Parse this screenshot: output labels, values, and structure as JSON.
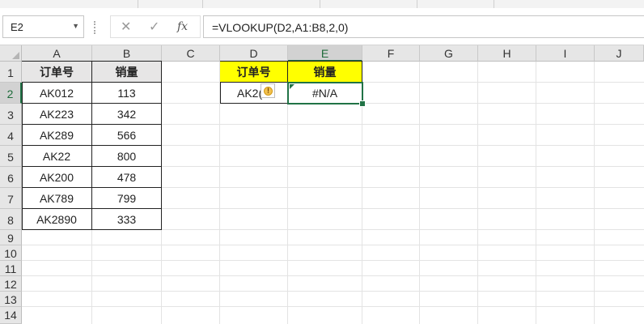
{
  "formula_bar": {
    "name_box": "E2",
    "cancel_icon": "✕",
    "enter_icon": "✓",
    "fx_label": "fx",
    "formula": "=VLOOKUP(D2,A1:B8,2,0)"
  },
  "columns": [
    "A",
    "B",
    "C",
    "D",
    "E",
    "F",
    "G",
    "H",
    "I",
    "J"
  ],
  "rows": [
    "1",
    "2",
    "3",
    "4",
    "5",
    "6",
    "7",
    "8",
    "9",
    "10",
    "11",
    "12",
    "13",
    "14"
  ],
  "selected": {
    "column": "E",
    "row": "2"
  },
  "table_left": {
    "headers": [
      "订单号",
      "销量"
    ],
    "rows": [
      [
        "AK012",
        "113"
      ],
      [
        "AK223",
        "342"
      ],
      [
        "AK289",
        "566"
      ],
      [
        "AK22",
        "800"
      ],
      [
        "AK200",
        "478"
      ],
      [
        "AK789",
        "799"
      ],
      [
        "AK2890",
        "333"
      ]
    ]
  },
  "table_right": {
    "headers": [
      "订单号",
      "销量"
    ],
    "lookup_value": "AK2(",
    "result": "#N/A"
  },
  "colors": {
    "accent": "#217346",
    "header_fill": "#e7e6e6",
    "highlight_fill": "#ffff00",
    "warning": "#f2c14e"
  },
  "icons": {
    "warning": "warning-icon",
    "dropdown": "chevron-down-icon"
  }
}
